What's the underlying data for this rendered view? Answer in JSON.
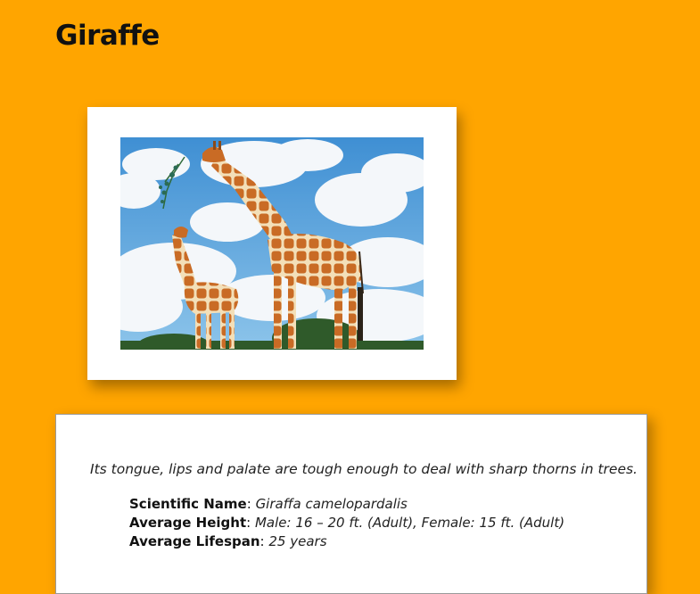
{
  "page": {
    "title": "Giraffe",
    "background_color": "#FFA500"
  },
  "photo": {
    "subject": "giraffe adult and calf photo"
  },
  "card": {
    "fact": "Its tongue, lips and palate are tough enough to deal with sharp thorns in trees.",
    "details": [
      {
        "label": "Scientific Name",
        "value": "Giraffa camelopardalis"
      },
      {
        "label": "Average Height",
        "value": "Male: 16 – 20 ft. (Adult), Female: 15 ft. (Adult)"
      },
      {
        "label": "Average Lifespan",
        "value": "25 years"
      }
    ],
    "separator": ":"
  }
}
